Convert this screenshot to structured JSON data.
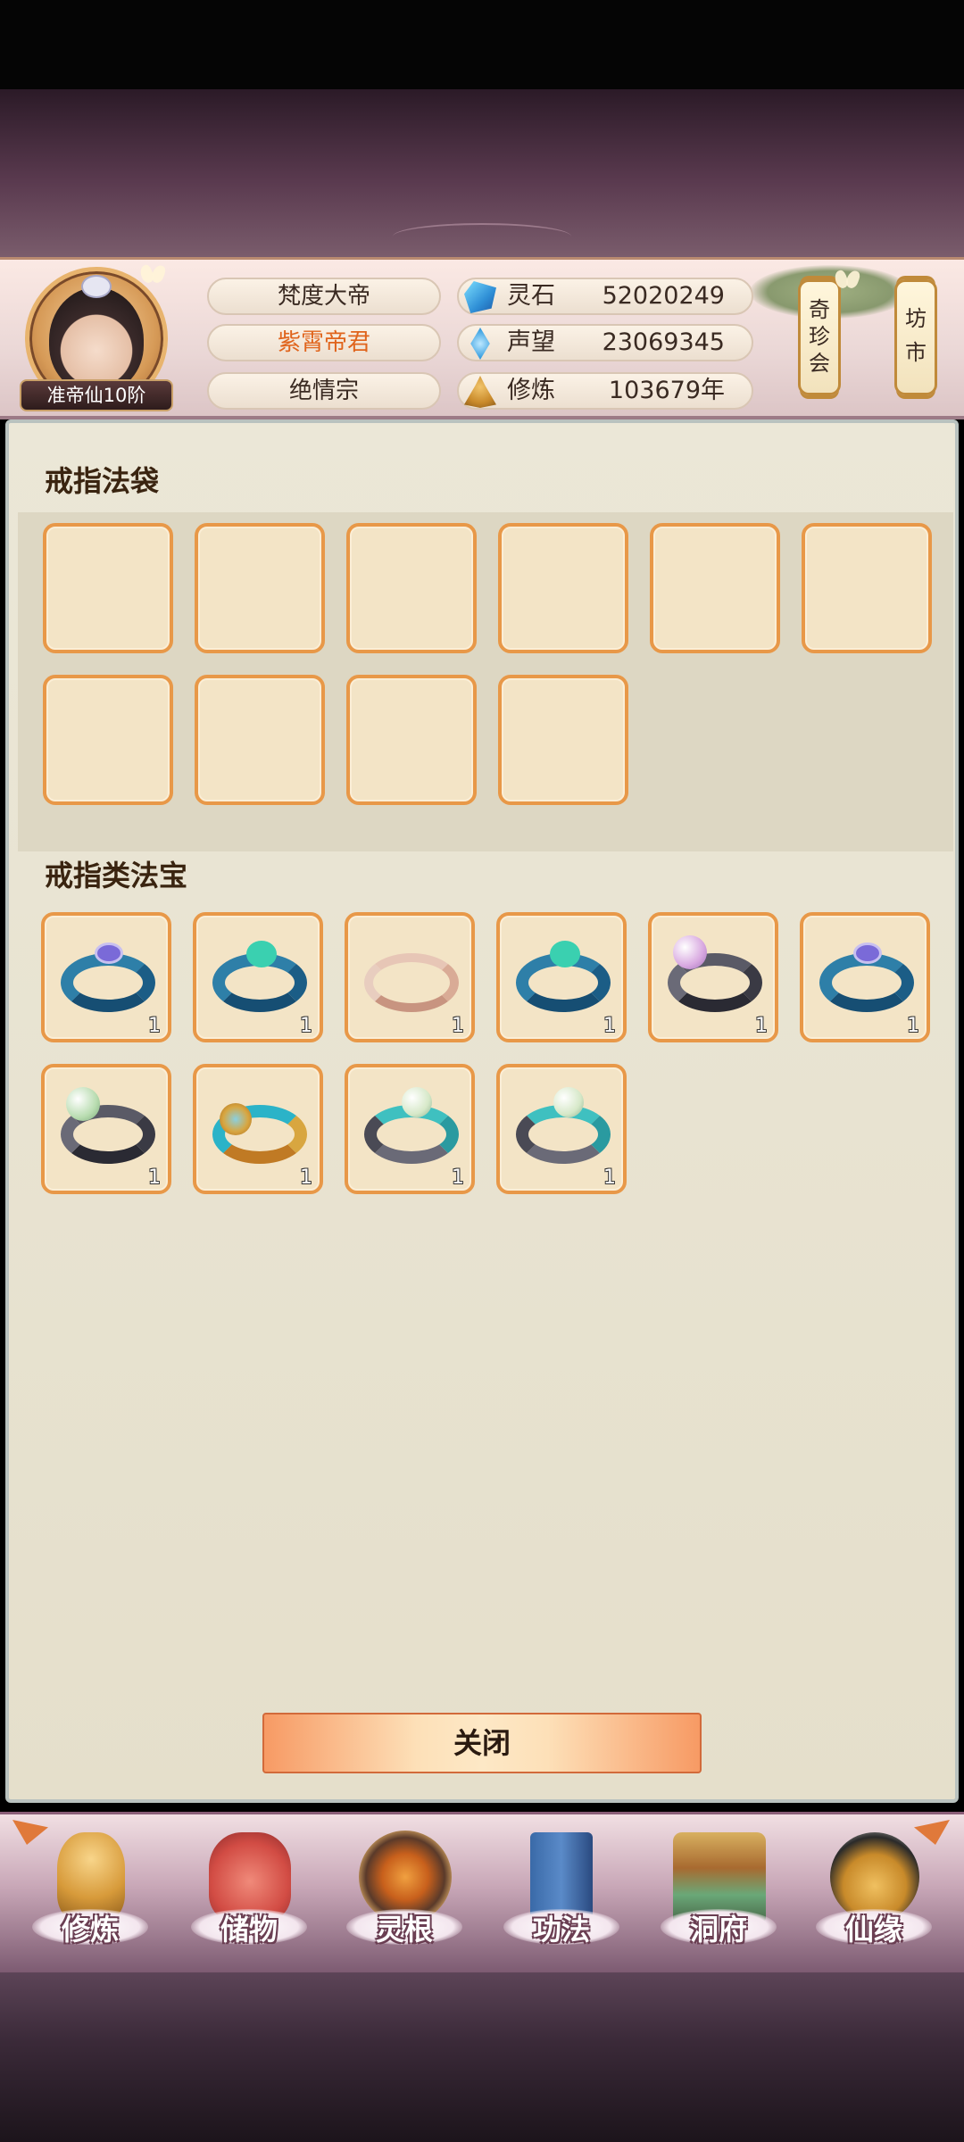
{
  "header": {
    "rank_label": "准帝仙10阶",
    "names": [
      "梵度大帝",
      "紫霄帝君",
      "绝情宗"
    ],
    "active_name_index": 1,
    "resources": [
      {
        "icon": "spirit-stone-icon",
        "label": "灵石",
        "value": "52020249"
      },
      {
        "icon": "reputation-icon",
        "label": "声望",
        "value": "23069345"
      },
      {
        "icon": "cultivation-icon",
        "label": "修炼",
        "value": "103679年"
      }
    ],
    "side_buttons": [
      {
        "label": [
          "奇",
          "珍",
          "会"
        ]
      },
      {
        "label": [
          "坊",
          "市"
        ]
      }
    ]
  },
  "panel": {
    "bag_title": "戒指法袋",
    "bag_slots": 10,
    "treasure_title": "戒指类法宝",
    "treasures": [
      {
        "icon": "blue-sapphire-ring-icon",
        "count": "1"
      },
      {
        "icon": "blue-jade-ring-icon",
        "count": "1"
      },
      {
        "icon": "rose-gold-ring-icon",
        "count": "1"
      },
      {
        "icon": "blue-jade-ring-icon",
        "count": "1"
      },
      {
        "icon": "pink-pearl-ring-icon",
        "count": "1"
      },
      {
        "icon": "blue-sapphire-ring-icon",
        "count": "1"
      },
      {
        "icon": "green-pearl-ring-icon",
        "count": "1"
      },
      {
        "icon": "golden-ornate-ring-icon",
        "count": "1"
      },
      {
        "icon": "teal-pearl-ring-icon",
        "count": "1"
      },
      {
        "icon": "teal-pearl-ring-icon",
        "count": "1"
      }
    ],
    "close_label": "关闭"
  },
  "bottom_nav": [
    {
      "label": "修炼",
      "icon": "cultivator-icon"
    },
    {
      "label": "储物",
      "icon": "storage-bag-icon"
    },
    {
      "label": "灵根",
      "icon": "spirit-root-icon"
    },
    {
      "label": "功法",
      "icon": "technique-book-icon"
    },
    {
      "label": "洞府",
      "icon": "cave-mansion-icon"
    },
    {
      "label": "仙缘",
      "icon": "fate-gourd-icon"
    }
  ]
}
